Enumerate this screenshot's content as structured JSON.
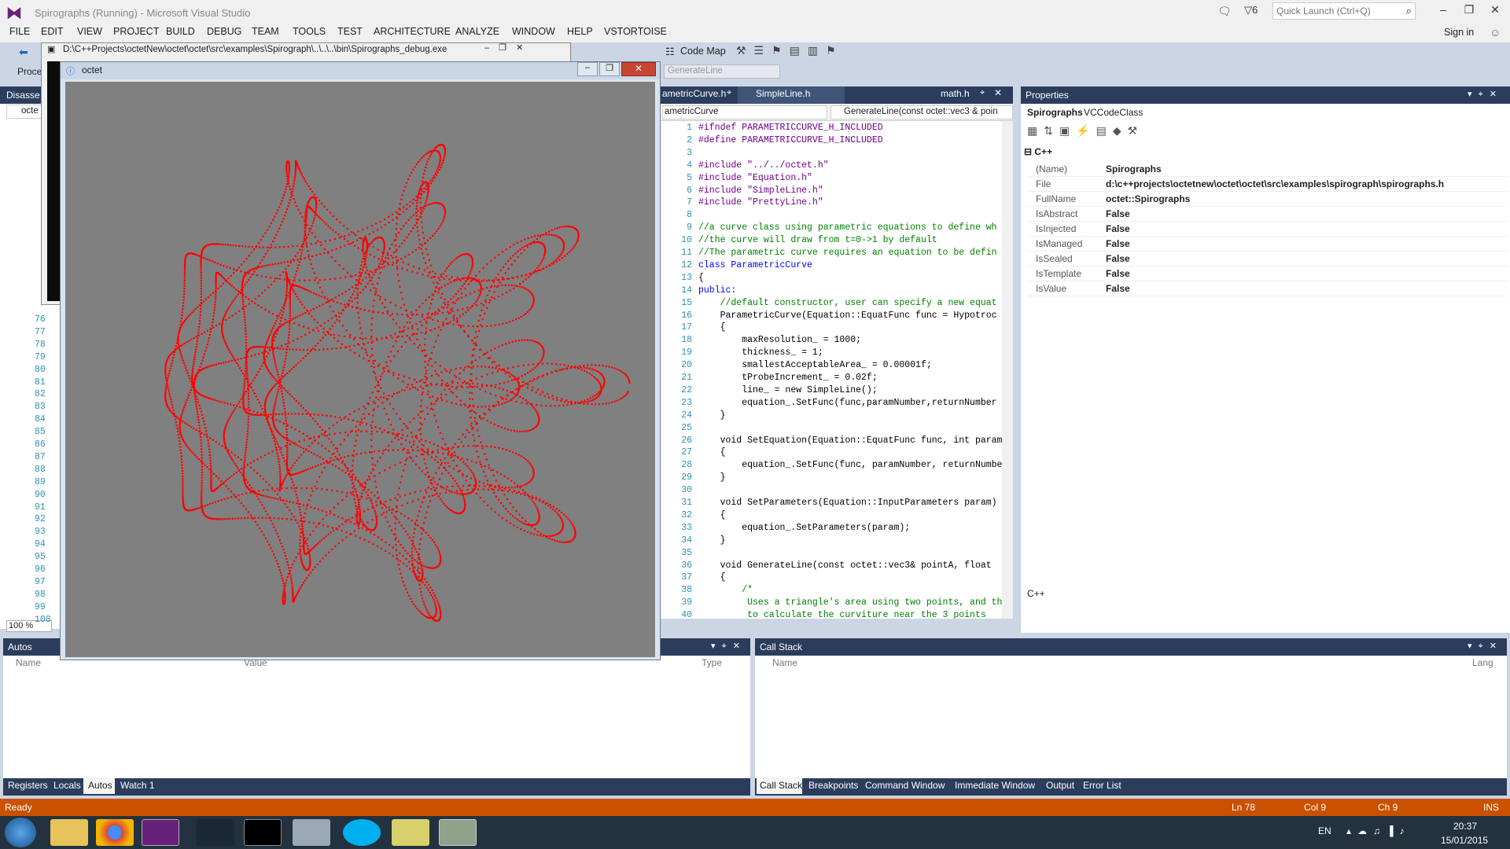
{
  "window": {
    "title": "Spirographs (Running) - Microsoft Visual Studio",
    "notifications_count": "6",
    "quick_launch_placeholder": "Quick Launch (Ctrl+Q)",
    "sign_in": "Sign in"
  },
  "menu": [
    "FILE",
    "EDIT",
    "VIEW",
    "PROJECT",
    "BUILD",
    "DEBUG",
    "TEAM",
    "TOOLS",
    "TEST",
    "ARCHITECTURE",
    "ANALYZE",
    "WINDOW",
    "HELP",
    "VSTORTOISE"
  ],
  "toolbar": {
    "code_map": "Code Map",
    "process_label": "Proce",
    "generate_line_combo": "GenerateLine"
  },
  "console": {
    "title": "D:\\C++Projects\\octetNew\\octet\\octet\\src\\examples\\Spirograph\\..\\..\\..\\bin\\Spirographs_debug.exe"
  },
  "octet_window": {
    "title": "octet"
  },
  "left_panel": {
    "title": "Disasse",
    "combo": "octe",
    "line_numbers": [
      "76",
      "77",
      "78",
      "79",
      "80",
      "81",
      "82",
      "83",
      "84",
      "85",
      "86",
      "87",
      "88",
      "89",
      "90",
      "91",
      "92",
      "93",
      "94",
      "95",
      "96",
      "97",
      "98",
      "99",
      "100"
    ],
    "zoom": "100 %"
  },
  "editor": {
    "tabs": [
      {
        "label": "ametricCurve.h"
      },
      {
        "label": "SimpleLine.h"
      },
      {
        "label": "math.h"
      }
    ],
    "class_combo": "ametricCurve",
    "member_combo": "GenerateLine(const octet::vec3 & poin",
    "lines": [
      {
        "n": "1",
        "t": "#ifndef PARAMETRICCURVE_H_INCLUDED",
        "c": "pp"
      },
      {
        "n": "2",
        "t": "#define PARAMETRICCURVE_H_INCLUDED",
        "c": "pp"
      },
      {
        "n": "3",
        "t": "",
        "c": ""
      },
      {
        "n": "4",
        "t": "#include \"../../octet.h\"",
        "c": "pp"
      },
      {
        "n": "5",
        "t": "#include \"Equation.h\"",
        "c": "pp"
      },
      {
        "n": "6",
        "t": "#include \"SimpleLine.h\"",
        "c": "pp"
      },
      {
        "n": "7",
        "t": "#include \"PrettyLine.h\"",
        "c": "pp"
      },
      {
        "n": "8",
        "t": "",
        "c": ""
      },
      {
        "n": "9",
        "t": "//a curve class using parametric equations to define wh",
        "c": "cm"
      },
      {
        "n": "10",
        "t": "//the curve will draw from t=0->1 by default",
        "c": "cm"
      },
      {
        "n": "11",
        "t": "//The parametric curve requires an equation to be defin",
        "c": "cm"
      },
      {
        "n": "12",
        "t": "class ParametricCurve",
        "c": "kw"
      },
      {
        "n": "13",
        "t": "{",
        "c": ""
      },
      {
        "n": "14",
        "t": "public:",
        "c": "kw"
      },
      {
        "n": "15",
        "t": "    //default constructor, user can specify a new equat",
        "c": "cm"
      },
      {
        "n": "16",
        "t": "    ParametricCurve(Equation::EquatFunc func = Hypotroc",
        "c": ""
      },
      {
        "n": "17",
        "t": "    {",
        "c": ""
      },
      {
        "n": "18",
        "t": "        maxResolution_ = 1000;",
        "c": ""
      },
      {
        "n": "19",
        "t": "        thickness_ = 1;",
        "c": ""
      },
      {
        "n": "20",
        "t": "        smallestAcceptableArea_ = 0.00001f;",
        "c": ""
      },
      {
        "n": "21",
        "t": "        tProbeIncrement_ = 0.02f;",
        "c": ""
      },
      {
        "n": "22",
        "t": "        line_ = new SimpleLine();",
        "c": ""
      },
      {
        "n": "23",
        "t": "        equation_.SetFunc(func,paramNumber,returnNumber",
        "c": ""
      },
      {
        "n": "24",
        "t": "    }",
        "c": ""
      },
      {
        "n": "25",
        "t": "",
        "c": ""
      },
      {
        "n": "26",
        "t": "    void SetEquation(Equation::EquatFunc func, int param",
        "c": ""
      },
      {
        "n": "27",
        "t": "    {",
        "c": ""
      },
      {
        "n": "28",
        "t": "        equation_.SetFunc(func, paramNumber, returnNumbe",
        "c": ""
      },
      {
        "n": "29",
        "t": "    }",
        "c": ""
      },
      {
        "n": "30",
        "t": "",
        "c": ""
      },
      {
        "n": "31",
        "t": "    void SetParameters(Equation::InputParameters param)",
        "c": ""
      },
      {
        "n": "32",
        "t": "    {",
        "c": ""
      },
      {
        "n": "33",
        "t": "        equation_.SetParameters(param);",
        "c": ""
      },
      {
        "n": "34",
        "t": "    }",
        "c": ""
      },
      {
        "n": "35",
        "t": "",
        "c": ""
      },
      {
        "n": "36",
        "t": "    void GenerateLine(const octet::vec3& pointA, float ",
        "c": ""
      },
      {
        "n": "37",
        "t": "    {",
        "c": ""
      },
      {
        "n": "38",
        "t": "        /*",
        "c": "cm"
      },
      {
        "n": "39",
        "t": "         Uses a triangle's area using two points, and th",
        "c": "cm"
      },
      {
        "n": "40",
        "t": "         to calculate the curviture near the 3 points",
        "c": "cm"
      }
    ]
  },
  "properties": {
    "title": "Properties",
    "object": "Spirographs",
    "object_type": "VCCodeClass",
    "category": "C++",
    "rows": [
      {
        "name": "(Name)",
        "value": "Spirographs"
      },
      {
        "name": "File",
        "value": "d:\\c++projects\\octetnew\\octet\\octet\\src\\examples\\spirograph\\spirographs.h"
      },
      {
        "name": "FullName",
        "value": "octet::Spirographs"
      },
      {
        "name": "IsAbstract",
        "value": "False"
      },
      {
        "name": "IsInjected",
        "value": "False"
      },
      {
        "name": "IsManaged",
        "value": "False"
      },
      {
        "name": "IsSealed",
        "value": "False"
      },
      {
        "name": "IsTemplate",
        "value": "False"
      },
      {
        "name": "IsValue",
        "value": "False"
      }
    ],
    "description": "C++"
  },
  "autos": {
    "title": "Autos",
    "columns": [
      "Name",
      "Value",
      "Type"
    ],
    "tabs": [
      "Registers",
      "Locals",
      "Autos",
      "Watch 1"
    ]
  },
  "callstack": {
    "title": "Call Stack",
    "columns": [
      "Name",
      "Lang"
    ],
    "tabs": [
      "Call Stack",
      "Breakpoints",
      "Command Window",
      "Immediate Window",
      "Output",
      "Error List"
    ]
  },
  "status": {
    "ready": "Ready",
    "line": "Ln 78",
    "col": "Col 9",
    "ch": "Ch 9",
    "ins": "INS"
  },
  "taskbar": {
    "lang": "EN",
    "time": "20:37",
    "date": "15/01/2015"
  }
}
